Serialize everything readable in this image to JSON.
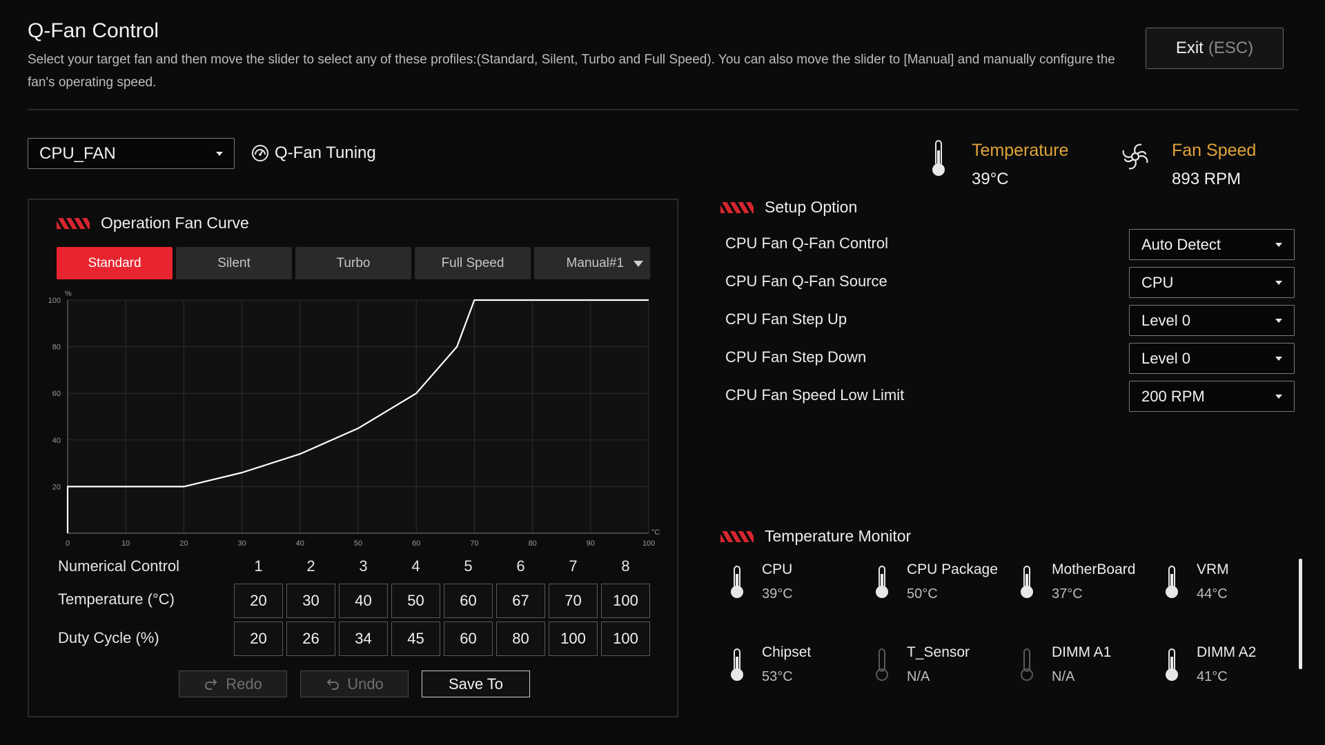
{
  "header": {
    "title": "Q-Fan Control",
    "description": "Select your target fan and then move the slider to select any of these profiles:(Standard, Silent, Turbo and Full Speed). You can also move the slider to [Manual] and manually configure the fan's operating speed.",
    "exit_label": "Exit",
    "exit_key": "(ESC)"
  },
  "fan_select": {
    "value": "CPU_FAN"
  },
  "tuning": {
    "label": "Q-Fan Tuning"
  },
  "status": {
    "temperature_label": "Temperature",
    "temperature_value": "39°C",
    "fan_speed_label": "Fan Speed",
    "fan_speed_value": "893 RPM",
    "accent_color": "#e0a43a"
  },
  "curve_panel": {
    "title": "Operation Fan Curve",
    "tabs": [
      "Standard",
      "Silent",
      "Turbo",
      "Full Speed",
      "Manual#1"
    ],
    "active_tab": "Standard"
  },
  "chart_data": {
    "type": "line",
    "x": [
      0,
      20,
      30,
      40,
      50,
      60,
      67,
      70,
      100
    ],
    "series": [
      {
        "values": [
          20,
          20,
          26,
          34,
          45,
          60,
          80,
          100,
          100
        ]
      }
    ],
    "x_ticks": [
      "0",
      "10",
      "20",
      "30",
      "40",
      "50",
      "60",
      "70",
      "80",
      "90",
      "100"
    ],
    "y_ticks": [
      "20",
      "40",
      "60",
      "80",
      "100"
    ],
    "x_unit": "°C",
    "y_unit": "%",
    "xlim": [
      0,
      100
    ],
    "ylim": [
      0,
      100
    ],
    "grid": true
  },
  "numerical": {
    "label": "Numerical Control",
    "points": [
      "1",
      "2",
      "3",
      "4",
      "5",
      "6",
      "7",
      "8"
    ],
    "temperature_label": "Temperature (°C)",
    "temperature": [
      "20",
      "30",
      "40",
      "50",
      "60",
      "67",
      "70",
      "100"
    ],
    "duty_label": "Duty Cycle (%)",
    "duty": [
      "20",
      "26",
      "34",
      "45",
      "60",
      "80",
      "100",
      "100"
    ]
  },
  "actions": {
    "redo": "Redo",
    "undo": "Undo",
    "save": "Save To"
  },
  "setup": {
    "title": "Setup Option",
    "options": [
      {
        "label": "CPU Fan Q-Fan Control",
        "value": "Auto Detect"
      },
      {
        "label": "CPU Fan Q-Fan Source",
        "value": "CPU"
      },
      {
        "label": "CPU Fan Step Up",
        "value": "Level 0"
      },
      {
        "label": "CPU Fan Step Down",
        "value": "Level 0"
      },
      {
        "label": "CPU Fan Speed Low Limit",
        "value": "200 RPM"
      }
    ]
  },
  "monitor": {
    "title": "Temperature Monitor",
    "items": [
      {
        "name": "CPU",
        "value": "39°C"
      },
      {
        "name": "CPU Package",
        "value": "50°C"
      },
      {
        "name": "MotherBoard",
        "value": "37°C"
      },
      {
        "name": "VRM",
        "value": "44°C"
      },
      {
        "name": "Chipset",
        "value": "53°C"
      },
      {
        "name": "T_Sensor",
        "value": "N/A"
      },
      {
        "name": "DIMM A1",
        "value": "N/A"
      },
      {
        "name": "DIMM A2",
        "value": "41°C"
      }
    ]
  },
  "colors": {
    "brand_red": "#e8252f",
    "stripe_red": "#d8262f",
    "background": "#0b0b0b"
  }
}
